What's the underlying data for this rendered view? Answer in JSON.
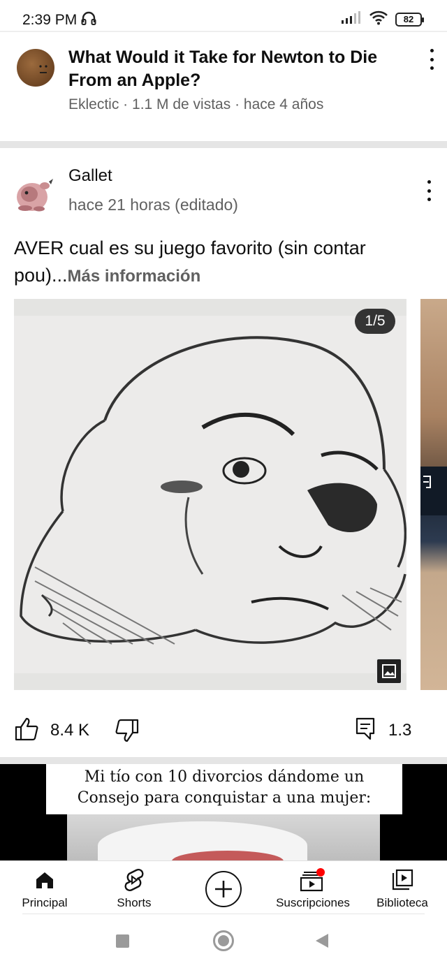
{
  "status_bar": {
    "time": "2:39 PM",
    "battery": "82",
    "icons": [
      "headphones-icon",
      "signal-icon",
      "wifi-icon",
      "battery-icon"
    ]
  },
  "video": {
    "title": "What Would it Take for Newton to Die From an Apple?",
    "meta": "Eklectic · 1.1 M de vistas · hace 4 años"
  },
  "post": {
    "author": "Gallet",
    "time": "hace 21 horas (editado)",
    "text": "AVER cual es su juego favorito (sin contar pou)...",
    "more": "Más información",
    "image_counter": "1/5",
    "likes": "8.4 K",
    "comments": "1.3"
  },
  "next_video": {
    "caption_line1": "Mi tío con 10 divorcios dándome un",
    "caption_line2": "Consejo para conquistar a una mujer:"
  },
  "bottom_nav": {
    "home": "Principal",
    "shorts": "Shorts",
    "subscriptions": "Suscripciones",
    "library": "Biblioteca"
  },
  "colors": {
    "text_primary": "#0f0f0f",
    "text_secondary": "#606060",
    "notification_dot": "#ff0000"
  }
}
